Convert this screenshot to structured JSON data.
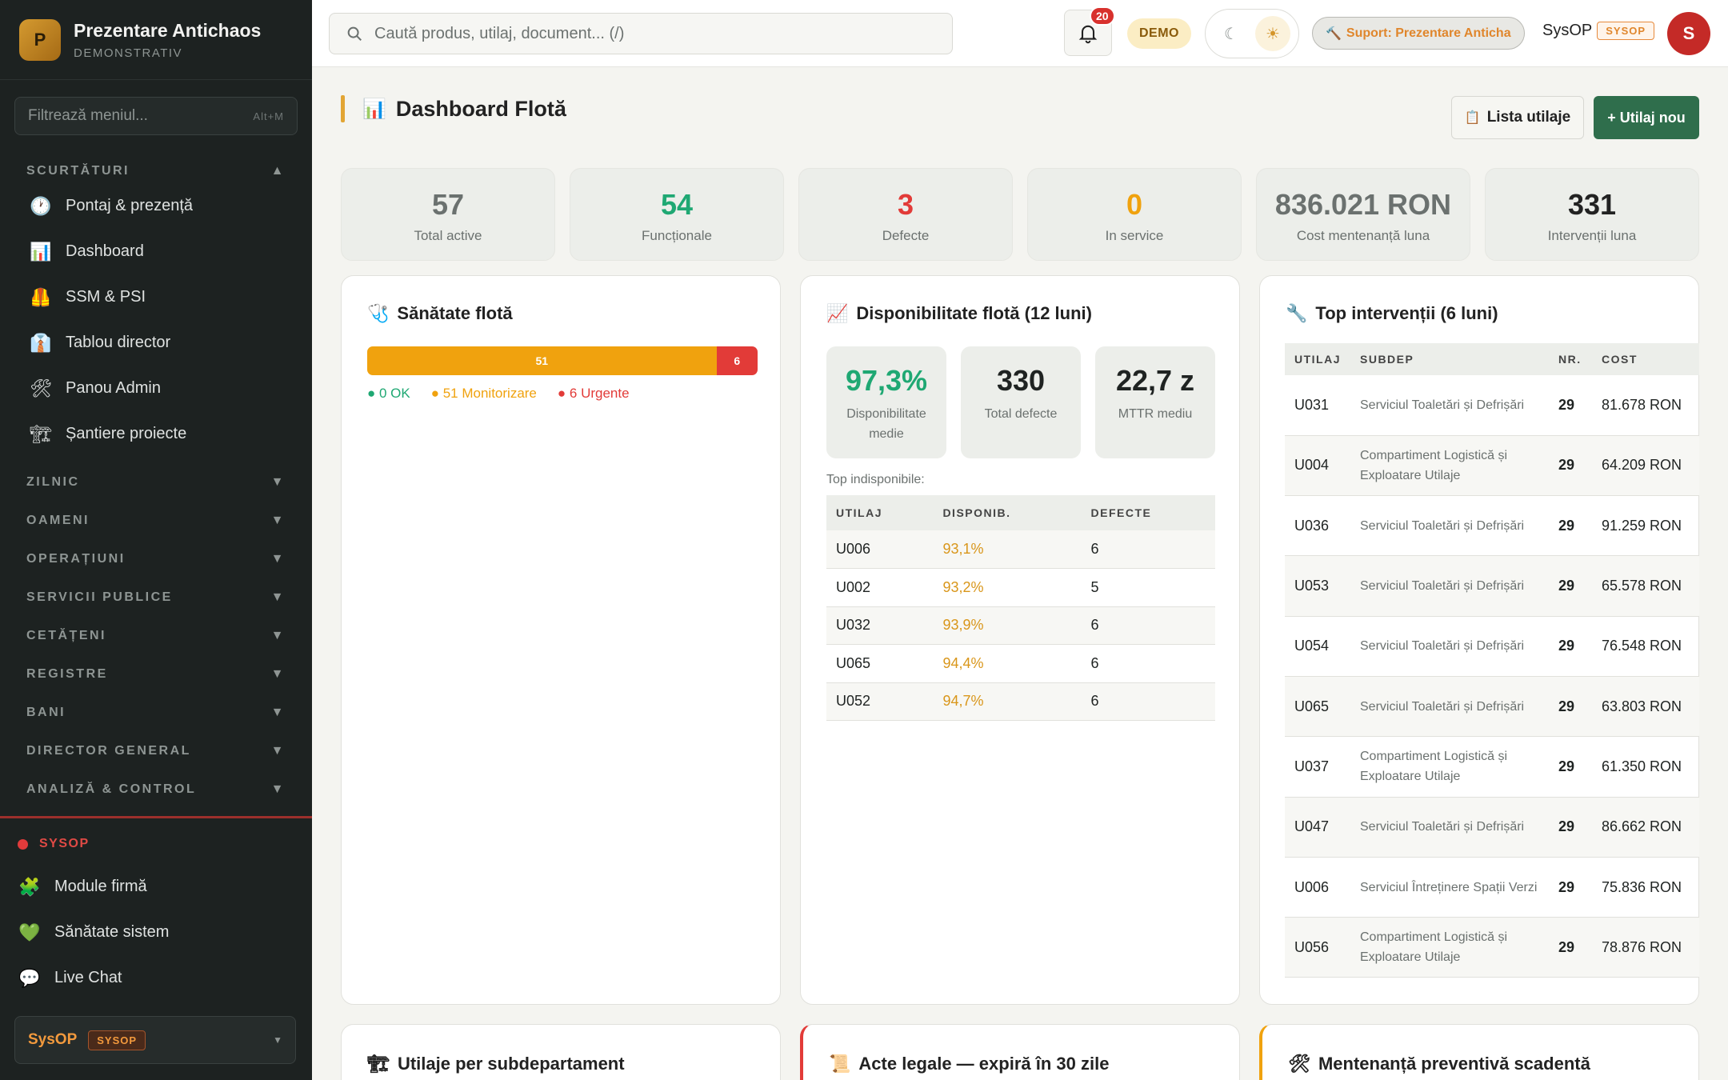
{
  "brand": {
    "logo_letter": "P",
    "name": "Prezentare Antichaos",
    "subtitle": "DEMONSTRATIV"
  },
  "sidebar": {
    "filter_placeholder": "Filtrează meniul...",
    "filter_shortcut": "Alt+M",
    "shortcuts_title": "SCURTĂTURI",
    "shortcuts": [
      {
        "label": "Pontaj & prezență",
        "icon": "clock-icon"
      },
      {
        "label": "Dashboard",
        "icon": "bar-chart-icon"
      },
      {
        "label": "SSM & PSI",
        "icon": "safety-vest-icon"
      },
      {
        "label": "Tablou director",
        "icon": "suit-icon"
      },
      {
        "label": "Panou Admin",
        "icon": "tools-icon"
      },
      {
        "label": "Șantiere proiecte",
        "icon": "construction-icon"
      }
    ],
    "sections": [
      "ZILNIC",
      "OAMENI",
      "OPERAȚIUNI",
      "SERVICII PUBLICE",
      "CETĂȚENI",
      "REGISTRE",
      "BANI",
      "DIRECTOR GENERAL",
      "ANALIZĂ & CONTROL"
    ],
    "sysop_label": "SYSOP",
    "sysop_items": [
      {
        "label": "Module firmă",
        "icon": "puzzle-icon"
      },
      {
        "label": "Sănătate sistem",
        "icon": "heart-icon"
      },
      {
        "label": "Live Chat",
        "icon": "chat-bubble-icon"
      }
    ],
    "user": {
      "name": "SysOP",
      "role": "SYSOP"
    }
  },
  "topbar": {
    "search_placeholder": "Caută produs, utilaj, document... (/)",
    "notifications_count": "20",
    "demo_badge": "DEMO",
    "support_label": "Suport: Prezentare Anticha",
    "user_name": "SysOP",
    "user_role": "SYSOP",
    "avatar_letter": "S"
  },
  "page": {
    "title": "Dashboard Flotă",
    "list_button": "Lista utilaje",
    "new_button": "+ Utilaj nou"
  },
  "kpis": [
    {
      "value": "57",
      "label": "Total active",
      "color": "#6b716f"
    },
    {
      "value": "54",
      "label": "Funcționale",
      "color": "#1fa873"
    },
    {
      "value": "3",
      "label": "Defecte",
      "color": "#e23b38"
    },
    {
      "value": "0",
      "label": "In service",
      "color": "#f0a20e"
    },
    {
      "value": "836.021 RON",
      "label": "Cost mentenanță luna",
      "color": "#6b716f"
    },
    {
      "value": "331",
      "label": "Intervenții luna",
      "color": "#222222"
    }
  ],
  "health": {
    "title": "Sănătate flotă",
    "monitor_count": "51",
    "urgent_count": "6",
    "monitor_fraction": 0.8947,
    "legend_ok": "● 0 OK",
    "legend_monitor": "● 51 Monitorizare",
    "legend_urgent": "● 6 Urgente"
  },
  "availability": {
    "title": "Disponibilitate flotă (12 luni)",
    "stats": [
      {
        "value": "97,3%",
        "label": "Disponibilitate medie",
        "color": "#1fa873"
      },
      {
        "value": "330",
        "label": "Total defecte",
        "color": "#222222"
      },
      {
        "value": "22,7 z",
        "label": "MTTR mediu",
        "color": "#222222"
      }
    ],
    "caption": "Top indisponibile:",
    "headers": [
      "UTILAJ",
      "DISPONIB.",
      "DEFECTE"
    ],
    "rows": [
      [
        "U006",
        "93,1%",
        "6"
      ],
      [
        "U002",
        "93,2%",
        "5"
      ],
      [
        "U032",
        "93,9%",
        "6"
      ],
      [
        "U065",
        "94,4%",
        "6"
      ],
      [
        "U052",
        "94,7%",
        "6"
      ]
    ]
  },
  "interventions": {
    "title": "Top intervenții (6 luni)",
    "headers": [
      "UTILAJ",
      "SUBDEP",
      "NR.",
      "COST"
    ],
    "rows": [
      [
        "U031",
        "Serviciul Toaletări și Defrișări",
        "29",
        "81.678 RON"
      ],
      [
        "U004",
        "Compartiment Logistică și Exploatare Utilaje",
        "29",
        "64.209 RON"
      ],
      [
        "U036",
        "Serviciul Toaletări și Defrișări",
        "29",
        "91.259 RON"
      ],
      [
        "U053",
        "Serviciul Toaletări și Defrișări",
        "29",
        "65.578 RON"
      ],
      [
        "U054",
        "Serviciul Toaletări și Defrișări",
        "29",
        "76.548 RON"
      ],
      [
        "U065",
        "Serviciul Toaletări și Defrișări",
        "29",
        "63.803 RON"
      ],
      [
        "U037",
        "Compartiment Logistică și Exploatare Utilaje",
        "29",
        "61.350 RON"
      ],
      [
        "U047",
        "Serviciul Toaletări și Defrișări",
        "29",
        "86.662 RON"
      ],
      [
        "U006",
        "Serviciul Întreținere Spații Verzi",
        "29",
        "75.836 RON"
      ],
      [
        "U056",
        "Compartiment Logistică și Exploatare Utilaje",
        "29",
        "78.876 RON"
      ]
    ]
  },
  "bottom_cards": [
    {
      "title": "Utilaje per subdepartament",
      "accent": ""
    },
    {
      "title": "Acte legale — expiră în 30 zile",
      "accent": "#e23b38"
    },
    {
      "title": "Mentenanță preventivă scadentă",
      "accent": "#f0a20e"
    }
  ]
}
